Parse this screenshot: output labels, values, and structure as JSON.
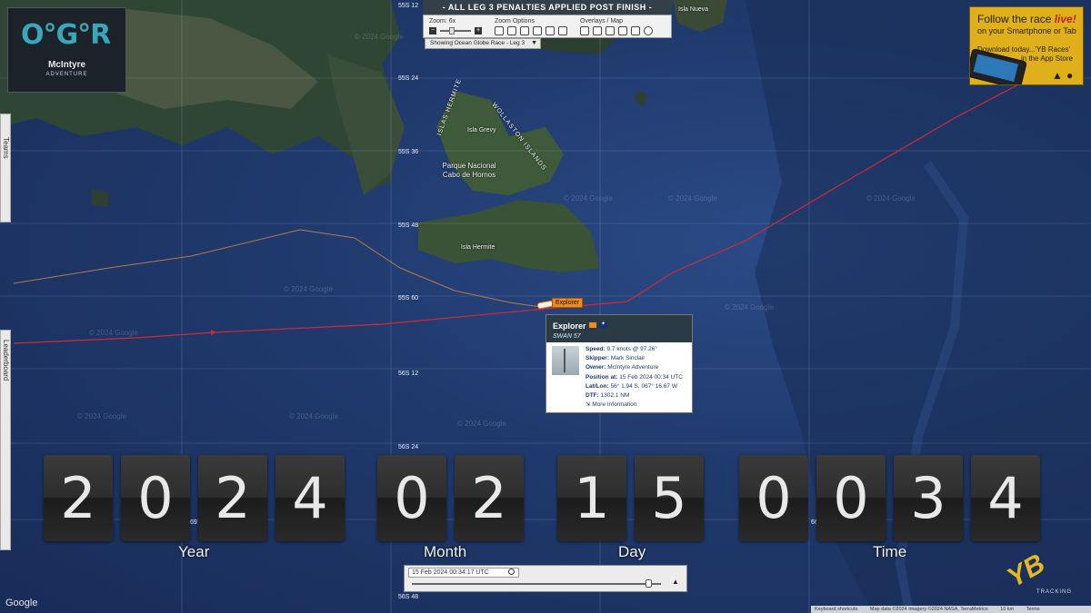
{
  "map": {
    "lat_labels": [
      "55S 12",
      "55S 24",
      "55S 36",
      "55S 48",
      "55S 60",
      "56S 12",
      "56S 24",
      "56S 48"
    ],
    "partial_labels": [
      "691",
      "66"
    ],
    "watermark": "© 2024 Google",
    "places": {
      "isla_nueva": "Isla Nueva",
      "isla_grevy": "Isla Grevy",
      "parque": "Parque Nacional Cabo de Hornos",
      "isla_hermite": "Isla Hermite",
      "islas_hermite_arc": "ISLAS HERMITE",
      "wollaston_arc": "WOLLASTON ISLANDS"
    },
    "colors": {
      "track_red": "#d02a35",
      "track_orange": "#d88a4a"
    }
  },
  "logo": {
    "mark": "O°G°R",
    "sponsor": "McIntyre",
    "sponsor_sub": "ADVENTURE"
  },
  "banner": "- ALL LEG 3 PENALTIES APPLIED POST FINISH -",
  "toolbar": {
    "zoom_label": "Zoom: 6x",
    "zoom_options_label": "Zoom Options",
    "overlays_label": "Overlays / Map",
    "showing": "Showing Ocean Globe Race - Leg 3"
  },
  "promo": {
    "line1_a": "Follow the race ",
    "line1_b": "live!",
    "line2": "on your Smartphone or Tab",
    "line3": "Download today...'YB Races'",
    "line4": "in the App Store",
    "apple_icon": "apple-icon",
    "android_icon": "android-icon"
  },
  "sidetabs": {
    "teams": "Teams",
    "leaderboard": "Leaderboard"
  },
  "boat": {
    "label": "Explorer",
    "name": "Explorer",
    "class": "SWAN 57",
    "flag_badge": "AUS",
    "speed_label": "Speed:",
    "speed": "9.7 knots @ 97.26°",
    "skipper_label": "Skipper:",
    "skipper": "Mark Sinclair",
    "owner_label": "Owner:",
    "owner": "McIntyre Adventure",
    "position_label": "Position at:",
    "position": "15 Feb 2024 00:34 UTC",
    "latlon_label": "Lat/Lon:",
    "latlon": "56° 1.94 S, 067° 16.67 W",
    "dtf_label": "DTF:",
    "dtf": "1302.1 NM",
    "more": "More Information"
  },
  "clock": {
    "digits": [
      "2",
      "0",
      "2",
      "4",
      "0",
      "2",
      "1",
      "5",
      "0",
      "0",
      "3",
      "4"
    ],
    "units": {
      "year": "Year",
      "month": "Month",
      "day": "Day",
      "time": "Time"
    }
  },
  "timeslider": {
    "datetime": "15 Feb 2024 00:34:17 UTC",
    "progress_fraction": 0.95
  },
  "footer": {
    "google": "Google",
    "shortcuts": "Keyboard shortcuts",
    "mapdata": "Map data ©2024 Imagery ©2024 NASA, TerraMetrics",
    "scale": "10 km",
    "terms": "Terms",
    "yb": "YB",
    "yb_sub": "TRACKING"
  }
}
